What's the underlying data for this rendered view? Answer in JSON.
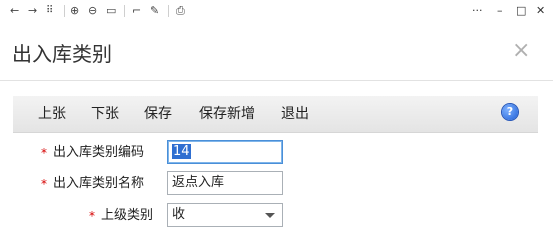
{
  "window": {
    "title": "出入库类别",
    "close_glyph": "×",
    "toolbar_icons": [
      "back-icon",
      "forward-icon",
      "apps-grid-icon",
      "zoom-in-icon",
      "zoom-out-icon",
      "fit-icon",
      "crop-icon",
      "edit-icon",
      "save-icon"
    ],
    "controls": {
      "more": "···",
      "minimize": "–",
      "maximize": "□",
      "close": "✕"
    }
  },
  "actions": {
    "prev": "上张",
    "next": "下张",
    "save": "保存",
    "save_new": "保存新增",
    "exit": "退出",
    "help": "?"
  },
  "form": {
    "required_mark": "*",
    "code_label": "出入库类别编码",
    "code_value": "14",
    "name_label": "出入库类别名称",
    "name_value": "返点入库",
    "parent_label": "上级类别",
    "parent_value": "收"
  },
  "colors": {
    "required": "#d60000",
    "selection": "#2f6fd1",
    "help_icon": "#1f5fd6"
  }
}
